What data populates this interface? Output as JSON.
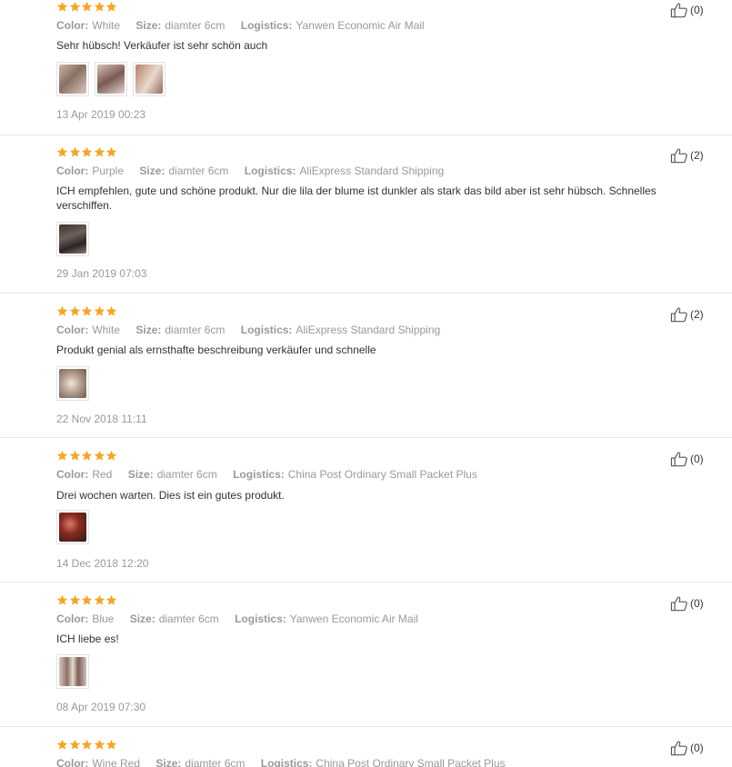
{
  "labels": {
    "color": "Color:",
    "size": "Size:",
    "logistics": "Logistics:"
  },
  "colors": {
    "star": "#f5a623",
    "divider": "#e6e6e6",
    "meta": "#999999",
    "text": "#333333"
  },
  "reviews": [
    {
      "rating": 5,
      "color": "White",
      "size": "diamter 6cm",
      "logistics": "Yanwen Economic Air Mail",
      "text": "Sehr hübsch! Verkäufer ist sehr schön auch",
      "photos": 3,
      "date": "13 Apr 2019 00:23",
      "helpful": "(0)"
    },
    {
      "rating": 5,
      "color": "Purple",
      "size": "diamter 6cm",
      "logistics": "AliExpress Standard Shipping",
      "text": "ICH empfehlen, gute und schöne produkt. Nur die lila der blume ist dunkler als stark das bild aber ist sehr hübsch. Schnelles verschiffen.",
      "photos": 1,
      "date": "29 Jan 2019 07:03",
      "helpful": "(2)"
    },
    {
      "rating": 5,
      "color": "White",
      "size": "diamter 6cm",
      "logistics": "AliExpress Standard Shipping",
      "text": "Produkt genial als ernsthafte beschreibung verkäufer und schnelle",
      "photos": 1,
      "date": "22 Nov 2018 11:11",
      "helpful": "(2)"
    },
    {
      "rating": 5,
      "color": "Red",
      "size": "diamter 6cm",
      "logistics": "China Post Ordinary Small Packet Plus",
      "text": "Drei wochen warten. Dies ist ein gutes produkt.",
      "photos": 1,
      "date": "14 Dec 2018 12:20",
      "helpful": "(0)"
    },
    {
      "rating": 5,
      "color": "Blue",
      "size": "diamter 6cm",
      "logistics": "Yanwen Economic Air Mail",
      "text": "ICH liebe es!",
      "photos": 1,
      "date": "08 Apr 2019 07:30",
      "helpful": "(0)"
    },
    {
      "rating": 5,
      "color": "Wine Red",
      "size": "diamter 6cm",
      "logistics": "China Post Ordinary Small Packet Plus",
      "text": "",
      "photos": 0,
      "date": "",
      "helpful": "(0)"
    }
  ]
}
